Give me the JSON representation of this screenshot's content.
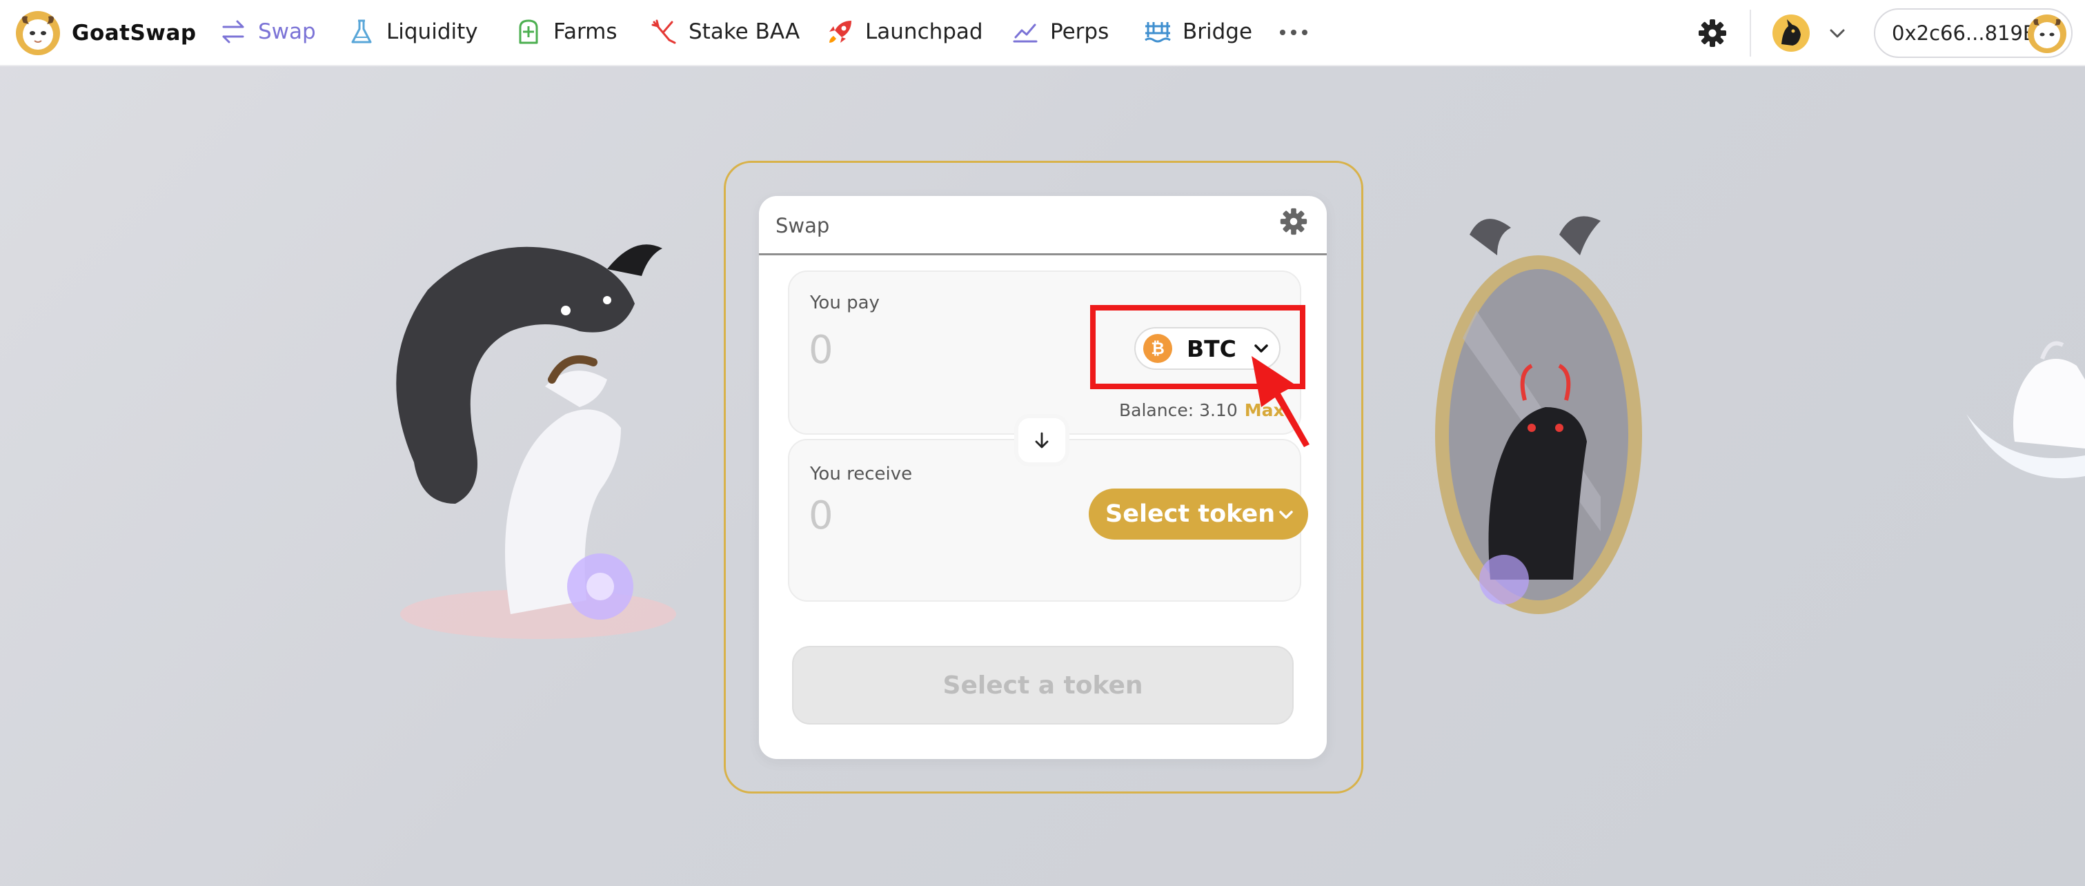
{
  "app": {
    "brand_name": "GoatSwap",
    "accent_color": "#7b73d6",
    "gold_color": "#d7aa40"
  },
  "nav": {
    "items": [
      {
        "label": "Swap",
        "icon": "swap-icon",
        "active": true
      },
      {
        "label": "Liquidity",
        "icon": "flask-icon",
        "active": false
      },
      {
        "label": "Farms",
        "icon": "farm-icon",
        "active": false
      },
      {
        "label": "Stake BAA",
        "icon": "stake-icon",
        "active": false
      },
      {
        "label": "Launchpad",
        "icon": "rocket-icon",
        "active": false
      },
      {
        "label": "Perps",
        "icon": "chart-line-icon",
        "active": false
      },
      {
        "label": "Bridge",
        "icon": "bridge-icon",
        "active": false
      }
    ],
    "more_icon": "more-dots-icon"
  },
  "header": {
    "settings_icon": "gear-icon",
    "network_icon": "network-icon",
    "wallet_address": "0x2c66...819B"
  },
  "swap": {
    "title": "Swap",
    "pay": {
      "label": "You pay",
      "amount_placeholder": "0",
      "token_symbol": "BTC",
      "balance_label": "Balance: 3.10",
      "max_label": "Max"
    },
    "receive": {
      "label": "You receive",
      "amount_placeholder": "0",
      "select_token_label": "Select token"
    },
    "submit_label": "Select a token"
  },
  "annotation": {
    "highlight_color": "#ee1a1a"
  }
}
